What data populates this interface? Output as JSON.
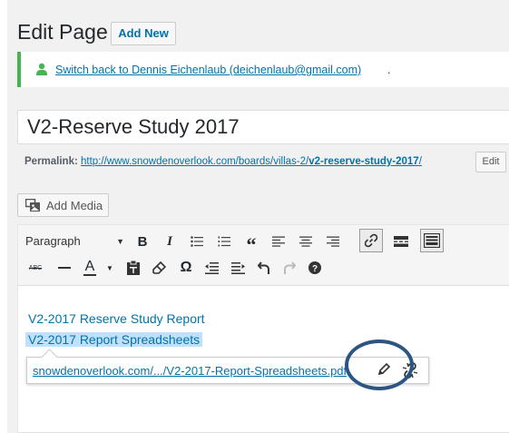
{
  "header": {
    "title": "Edit Page",
    "add_new_label": "Add New"
  },
  "notice": {
    "icon": "user-icon",
    "link_text": "Switch back to Dennis Eichenlaub (deichenlaub@gmail.com)",
    "trailing": ".",
    "color": "#46b450"
  },
  "post": {
    "title_value": "V2-Reserve Study 2017"
  },
  "permalink": {
    "label": "Permalink:",
    "url_base": "http://www.snowdenoverlook.com/boards/villas-2/",
    "slug": "v2-reserve-study-2017",
    "trailing": "/",
    "edit_label": "Edit"
  },
  "media": {
    "add_media_label": "Add Media",
    "icon": "media-icon"
  },
  "toolbar": {
    "format_value": "Paragraph",
    "row1": [
      "bold",
      "italic",
      "bulleted-list",
      "numbered-list",
      "blockquote",
      "align-left",
      "align-center",
      "align-right",
      "insert-link",
      "read-more",
      "toolbar-toggle"
    ],
    "row2": [
      "strikethrough",
      "horizontal-line",
      "text-color",
      "paste-as-text",
      "clear-formatting",
      "special-character",
      "outdent",
      "indent",
      "undo",
      "redo",
      "help"
    ],
    "strikethrough_glyph": "ABC",
    "text_color_glyph": "A",
    "special_char_glyph": "Ω",
    "bold_glyph": "B",
    "italic_glyph": "I",
    "quote_glyph": "“"
  },
  "content": {
    "line1": "V2-2017 Reserve Study Report",
    "line2": "V2-2017 Report Spreadsheets"
  },
  "link_popup": {
    "url_text": "snowdenoverlook.com/.../V2-2017-Report-Spreadsheets.pdf",
    "edit_icon": "pencil-icon",
    "unlink_icon": "unlink-icon"
  },
  "annotation": {
    "circle_color": "#2b5584"
  }
}
